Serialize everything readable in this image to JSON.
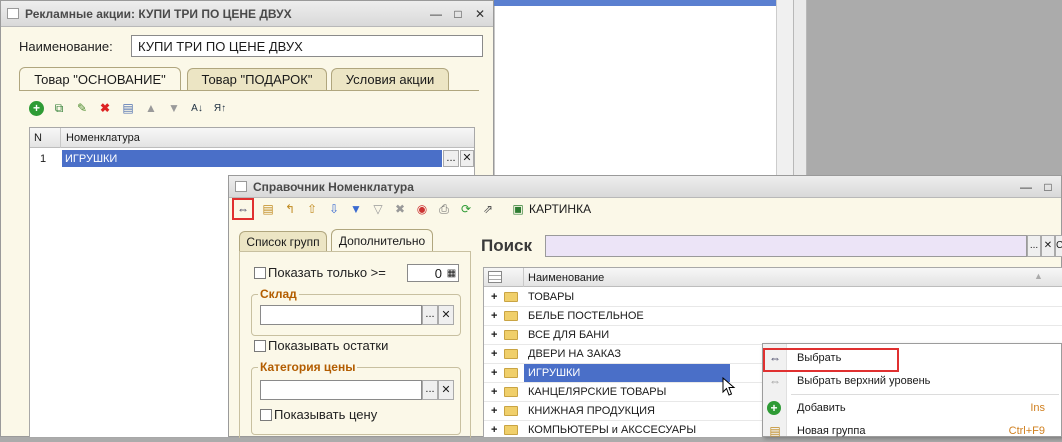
{
  "colors": {
    "selection": "#4a6fc8",
    "highlight_box": "#e03030",
    "group_title": "#b35d00"
  },
  "promo_window": {
    "title": "Рекламные акции: КУПИ ТРИ ПО ЦЕНЕ ДВУХ",
    "name_label": "Наименование:",
    "name_value": "КУПИ ТРИ ПО ЦЕНЕ ДВУХ",
    "tabs": [
      "Товар \"ОСНОВАНИЕ\"",
      "Товар \"ПОДАРОК\"",
      "Условия акции"
    ],
    "table": {
      "headers": [
        "N",
        "Номенклатура"
      ],
      "rows": [
        {
          "n": "1",
          "item": "ИГРУШКИ",
          "dots": "..."
        }
      ]
    }
  },
  "catalog_window": {
    "title": "Справочник Номенклатура",
    "toolbar_picture_label": "КАРТИНКА",
    "left_tabs": [
      "Список групп",
      "Дополнительно"
    ],
    "show_only_label": "Показать только >=",
    "show_only_value": "0",
    "warehouse_group": "Склад",
    "show_stock_label": "Показывать остатки",
    "price_category_group": "Категория цены",
    "show_price_label": "Показывать цену",
    "search_label": "Поиск",
    "list_header": "Наименование",
    "rows": [
      {
        "name": "ТОВАРЫ",
        "expand": "+",
        "selected": false
      },
      {
        "name": "БЕЛЬЕ ПОСТЕЛЬНОЕ",
        "expand": "+",
        "selected": false
      },
      {
        "name": "ВСЕ ДЛЯ БАНИ",
        "expand": "+",
        "selected": false
      },
      {
        "name": "ДВЕРИ НА ЗАКАЗ",
        "expand": "+",
        "selected": false
      },
      {
        "name": "ИГРУШКИ",
        "expand": "+",
        "selected": true
      },
      {
        "name": "КАНЦЕЛЯРСКИЕ ТОВАРЫ",
        "expand": "+",
        "selected": false
      },
      {
        "name": "КНИЖНАЯ ПРОДУКЦИЯ",
        "expand": "+",
        "selected": false
      },
      {
        "name": "КОМПЬЮТЕРЫ и АКССЕСУАРЫ",
        "expand": "+",
        "selected": false
      }
    ]
  },
  "context_menu": {
    "items": [
      {
        "label": "Выбрать",
        "shortcut": ""
      },
      {
        "label": "Выбрать верхний уровень",
        "shortcut": ""
      },
      {
        "label": "Добавить",
        "shortcut": "Ins"
      },
      {
        "label": "Новая группа",
        "shortcut": "Ctrl+F9"
      }
    ]
  }
}
